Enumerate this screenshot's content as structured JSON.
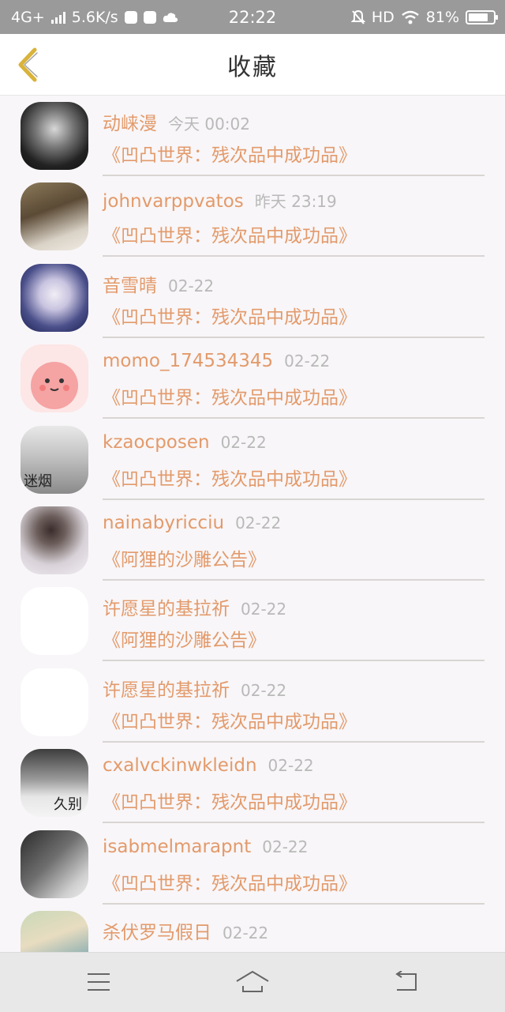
{
  "status_bar": {
    "network": "4G+",
    "speed": "5.6K/s",
    "time": "22:22",
    "hd": "HD",
    "battery": "81%",
    "battery_level": 0.81
  },
  "header": {
    "title": "收藏",
    "back_icon": "chevron-left-icon",
    "accent_color": "#d9b33a"
  },
  "favorites": [
    {
      "user": "动崃漫",
      "time": "今天 00:02",
      "book": "《凹凸世界：残次品中成功品》"
    },
    {
      "user": "johnvarppvatos",
      "time": "昨天 23:19",
      "book": "《凹凸世界：残次品中成功品》"
    },
    {
      "user": "音雪晴",
      "time": "02-22",
      "book": "《凹凸世界：残次品中成功品》"
    },
    {
      "user": "momo_174534345",
      "time": "02-22",
      "book": "《凹凸世界：残次品中成功品》"
    },
    {
      "user": "kzaocposen",
      "time": "02-22",
      "book": "《凹凸世界：残次品中成功品》",
      "avatar_text": "迷烟"
    },
    {
      "user": "nainabyricciu",
      "time": "02-22",
      "book": "《阿狸的沙雕公告》"
    },
    {
      "user": "许愿星的基拉祈",
      "time": "02-22",
      "book": "《阿狸的沙雕公告》"
    },
    {
      "user": "许愿星的基拉祈",
      "time": "02-22",
      "book": "《凹凸世界：残次品中成功品》"
    },
    {
      "user": "cxalvckinwkleidn",
      "time": "02-22",
      "book": "《凹凸世界：残次品中成功品》",
      "avatar_text": "久别"
    },
    {
      "user": "isabmelmarapnt",
      "time": "02-22",
      "book": "《凹凸世界：残次品中成功品》"
    },
    {
      "user": "杀伏罗马假日",
      "time": "02-22",
      "book": ""
    }
  ],
  "colors": {
    "name": "#e39a6b",
    "time": "#b9b9b9",
    "divider": "#d9d5d3"
  },
  "nav": {
    "menu_icon": "menu-icon",
    "home_icon": "home-icon",
    "back_icon": "back-icon"
  }
}
